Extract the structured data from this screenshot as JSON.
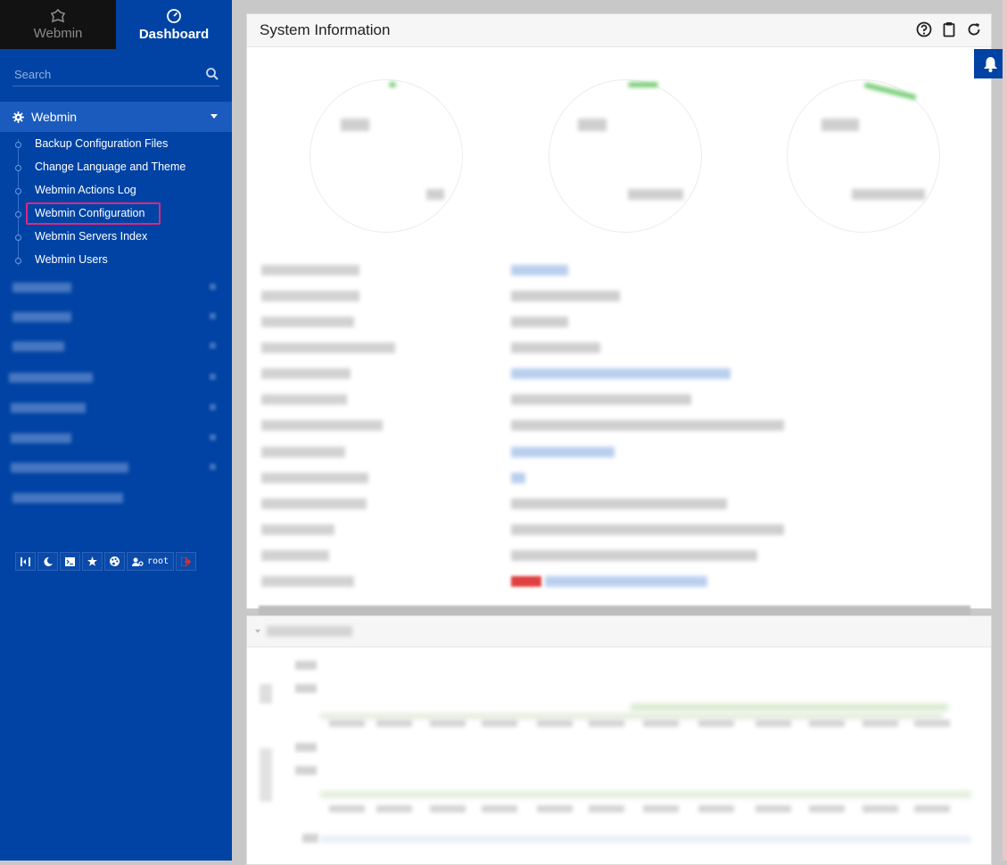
{
  "sidebar": {
    "tabs": [
      {
        "label": "Webmin",
        "icon": "webmin-logo-icon"
      },
      {
        "label": "Dashboard",
        "icon": "dashboard-gauge-icon"
      }
    ],
    "search": {
      "placeholder": "Search"
    },
    "section": {
      "label": "Webmin"
    },
    "items": [
      {
        "label": "Backup Configuration Files"
      },
      {
        "label": "Change Language and Theme"
      },
      {
        "label": "Webmin Actions Log"
      },
      {
        "label": "Webmin Configuration"
      },
      {
        "label": "Webmin Servers Index"
      },
      {
        "label": "Webmin Users"
      }
    ],
    "toolbar": {
      "user_label": "root"
    }
  },
  "panel": {
    "title": "System Information"
  },
  "colors": {
    "sidebar_bg": "#0043a4",
    "sidebar_active": "#1a5bbd",
    "highlight_box": "#e0267c",
    "gauge_green": "#7bcf7b"
  }
}
